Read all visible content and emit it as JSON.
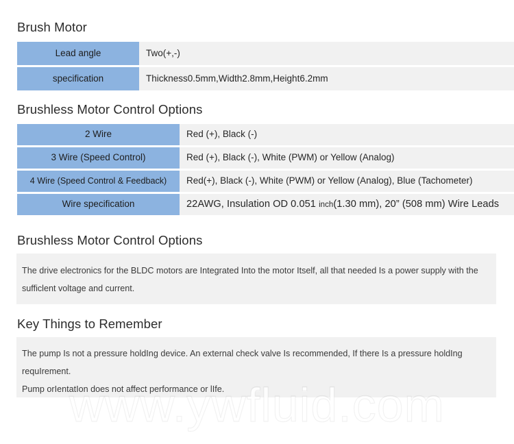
{
  "document": {
    "watermark": "www.ywfluid.com"
  },
  "sections": {
    "brush_motor": {
      "heading": "Brush Motor",
      "rows": [
        {
          "label": "Lead angle",
          "value": "Two(+,-)"
        },
        {
          "label": "specification",
          "value": "Thickness0.5mm,Width2.8mm,Height6.2mm"
        }
      ]
    },
    "bldc_control_table": {
      "heading": "Brushless Motor Control Options",
      "rows": [
        {
          "label": "2 Wire",
          "value": "Red (+), Black (-)"
        },
        {
          "label": "3 Wire (Speed Control)",
          "value": "Red (+), Black (-), White (PWM) or Yellow (Analog)"
        },
        {
          "label": "4 Wire (Speed Control & Feedback)",
          "value": "Red(+), Black (-), White (PWM) or Yellow (Analog), Blue (Tachometer)"
        },
        {
          "label": "Wire specification",
          "value_prefix": "22AWG, Insulation OD 0.051 ",
          "value_unit": "inch",
          "value_suffix": "(1.30 mm), 20” (508 mm) Wire Leads"
        }
      ]
    },
    "bldc_control_note": {
      "heading": "Brushless Motor Control Options",
      "paragraphs": [
        "The drive electronics for the BLDC motors are Integrated Into the motor Itself, all that needed Is a power supply with the sufficlent voltage and current."
      ]
    },
    "key_things": {
      "heading": "Key Things to Remember",
      "paragraphs": [
        "The pump Is not a pressure holdIng device. An external check valve Is recommended, If there Is a pressure holdIng requIrement.",
        "Pump orIentatIon does not affect performance or lIfe."
      ]
    }
  },
  "colors": {
    "header_blue": "#8CB3E0",
    "cell_gray": "#F1F1F1",
    "text": "#262626"
  }
}
